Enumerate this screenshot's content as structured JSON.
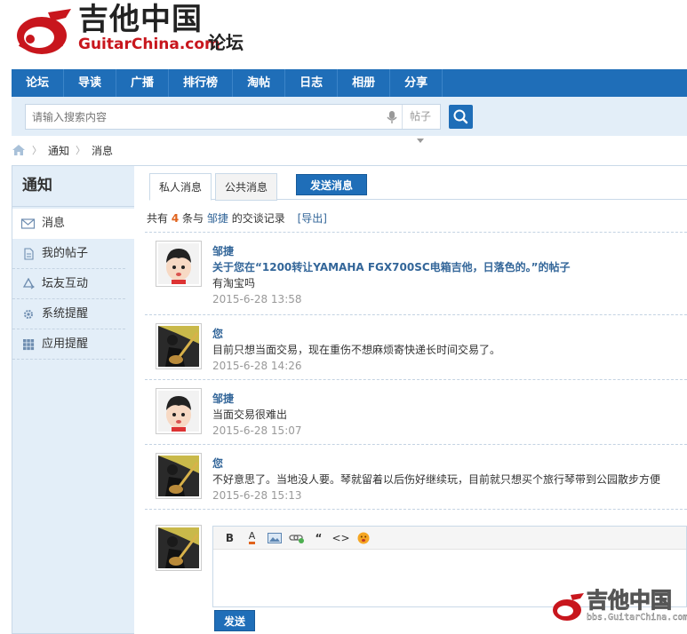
{
  "header": {
    "logo_cn": "吉他中国",
    "logo_en": "GuitarChina.com",
    "logo_forum": "论坛"
  },
  "nav": {
    "items": [
      "论坛",
      "导读",
      "广播",
      "排行榜",
      "淘帖",
      "日志",
      "相册",
      "分享"
    ]
  },
  "search": {
    "placeholder": "请输入搜索内容",
    "type": "帖子"
  },
  "breadcrumb": {
    "items": [
      "通知",
      "消息"
    ]
  },
  "sidebar": {
    "title": "通知",
    "items": [
      {
        "label": "消息",
        "icon": "envelope-icon"
      },
      {
        "label": "我的帖子",
        "icon": "document-icon"
      },
      {
        "label": "坛友互动",
        "icon": "recycle-icon"
      },
      {
        "label": "系统提醒",
        "icon": "gear-icon"
      },
      {
        "label": "应用提醒",
        "icon": "grid-icon"
      }
    ]
  },
  "tabs": {
    "private": "私人消息",
    "public": "公共消息",
    "send": "发送消息"
  },
  "summary": {
    "prefix": "共有",
    "count": "4",
    "middle": "条与",
    "user": "邹捷",
    "suffix": "的交谈记录",
    "export": "[导出]"
  },
  "messages": [
    {
      "author": "邹捷",
      "link": "关于您在“1200转让YAMAHA FGX700SC电箱吉他，日落色的。”的帖子",
      "text": "有淘宝吗",
      "time": "2015-6-28 13:58",
      "avatar": "cartoon-avatar"
    },
    {
      "author": "您",
      "link": "",
      "text": "目前只想当面交易，现在重伤不想麻烦寄快递长时间交易了。",
      "time": "2015-6-28 14:26",
      "avatar": "guitarist-avatar"
    },
    {
      "author": "邹捷",
      "link": "",
      "text": "当面交易很难出",
      "time": "2015-6-28 15:07",
      "avatar": "cartoon-avatar"
    },
    {
      "author": "您",
      "link": "",
      "text": "不好意思了。当地没人要。琴就留着以后伤好继续玩，目前就只想买个旅行琴带到公园散步方便",
      "time": "2015-6-28 15:13",
      "avatar": "guitarist-avatar"
    }
  ],
  "editor": {
    "tools": [
      "bold-icon",
      "font-color-icon",
      "image-icon",
      "link-icon",
      "quote-icon",
      "code-icon",
      "smiley-icon"
    ],
    "bold_label": "B",
    "color_label": "A",
    "quote_label": "“",
    "code_label": "<>",
    "send": "发送"
  },
  "watermark": {
    "cn": "吉他中国",
    "url": "bbs.GuitarChina.com"
  },
  "colors": {
    "brand_blue": "#1f6eb8",
    "brand_red": "#c8161d",
    "link_blue": "#336699",
    "count_orange": "#e0621c"
  }
}
